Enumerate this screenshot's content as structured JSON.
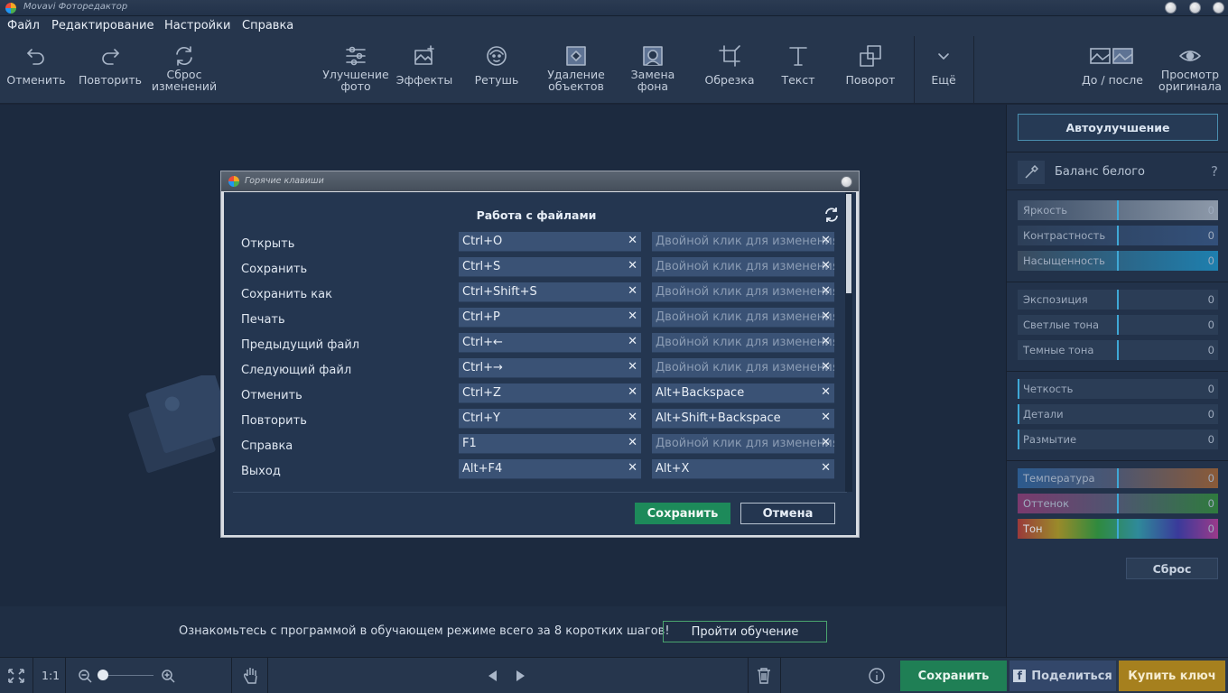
{
  "window": {
    "title": "Movavi Фоторедактор"
  },
  "menu": [
    "Файл",
    "Редактирование",
    "Настройки",
    "Справка"
  ],
  "toolbar": {
    "undo": "Отменить",
    "redo": "Повторить",
    "reset": "Сброс\nизменений",
    "enhance": "Улучшение\nфото",
    "effects": "Эффекты",
    "retouch": "Ретушь",
    "remove": "Удаление\nобъектов",
    "background": "Замена\nфона",
    "crop": "Обрезка",
    "text": "Текст",
    "rotate": "Поворот",
    "more": "Ещё",
    "before_after": "До / после",
    "preview": "Просмотр\nоригинала"
  },
  "panel": {
    "auto": "Автоулучшение",
    "white_balance": "Баланс белого",
    "help": "?",
    "sliders": [
      {
        "name": "Яркость",
        "value": "0"
      },
      {
        "name": "Контрастность",
        "value": "0"
      },
      {
        "name": "Насыщенность",
        "value": "0"
      },
      {
        "name": "Экспозиция",
        "value": "0"
      },
      {
        "name": "Светлые тона",
        "value": "0"
      },
      {
        "name": "Темные тона",
        "value": "0"
      },
      {
        "name": "Четкость",
        "value": "0"
      },
      {
        "name": "Детали",
        "value": "0"
      },
      {
        "name": "Размытие",
        "value": "0"
      },
      {
        "name": "Температура",
        "value": "0"
      },
      {
        "name": "Оттенок",
        "value": "0"
      },
      {
        "name": "Тон",
        "value": "0"
      }
    ],
    "reset": "Сброс"
  },
  "tutorial": {
    "message": "Ознакомьтесь с программой в обучающем режиме всего за 8 коротких шагов!",
    "button": "Пройти обучение"
  },
  "status": {
    "zoom_ratio": "1:1",
    "save": "Сохранить",
    "share": "Поделиться",
    "buy": "Купить ключ"
  },
  "dialog": {
    "title": "Горячие клавиши",
    "heading": "Работа с файлами",
    "placeholder": "Двойной клик для изменения",
    "rows": [
      {
        "action": "Открыть",
        "key1": "Ctrl+O",
        "key2": ""
      },
      {
        "action": "Сохранить",
        "key1": "Ctrl+S",
        "key2": ""
      },
      {
        "action": "Сохранить как",
        "key1": "Ctrl+Shift+S",
        "key2": ""
      },
      {
        "action": "Печать",
        "key1": "Ctrl+P",
        "key2": ""
      },
      {
        "action": "Предыдущий файл",
        "key1": "Ctrl+←",
        "key2": ""
      },
      {
        "action": "Следующий файл",
        "key1": "Ctrl+→",
        "key2": ""
      },
      {
        "action": "Отменить",
        "key1": "Ctrl+Z",
        "key2": "Alt+Backspace"
      },
      {
        "action": "Повторить",
        "key1": "Ctrl+Y",
        "key2": "Alt+Shift+Backspace"
      },
      {
        "action": "Справка",
        "key1": "F1",
        "key2": ""
      },
      {
        "action": "Выход",
        "key1": "Alt+F4",
        "key2": "Alt+X"
      }
    ],
    "save": "Сохранить",
    "cancel": "Отмена"
  }
}
